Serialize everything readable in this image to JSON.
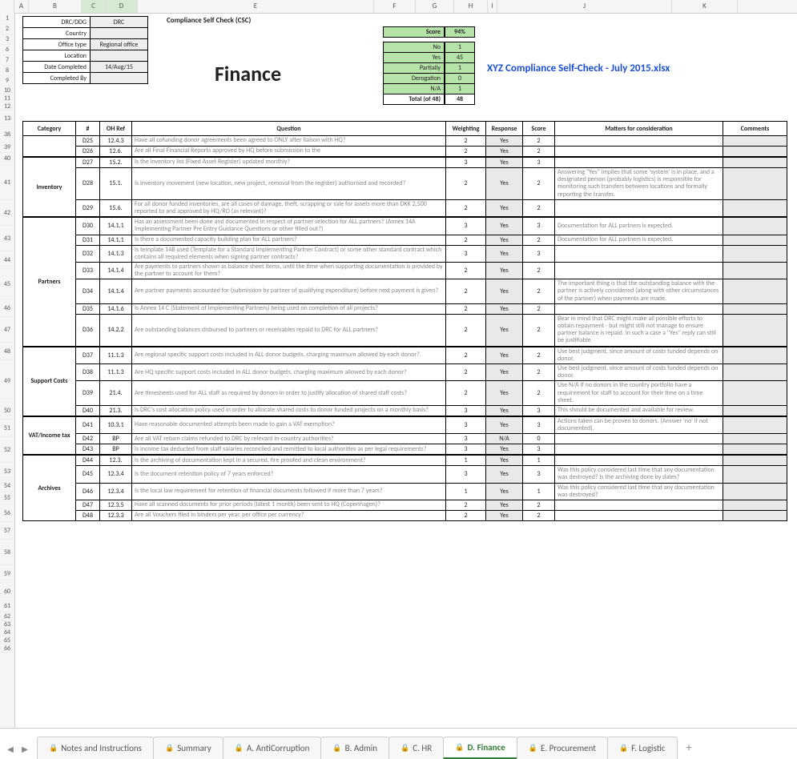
{
  "filename": "XYZ Compliance Self-Check - July 2015.xlsx",
  "header": {
    "title": "Compliance Self Check (CSC)",
    "section": "Finance"
  },
  "info": [
    {
      "label": "DRC/DDG",
      "value": "DRC"
    },
    {
      "label": "Country",
      "value": ""
    },
    {
      "label": "Office type",
      "value": "Regional office"
    },
    {
      "label": "Location",
      "value": ""
    },
    {
      "label": "Date Completed",
      "value": "14/Aug/15"
    },
    {
      "label": "Completed By",
      "value": ""
    }
  ],
  "score": {
    "label": "Score",
    "pct": "94%"
  },
  "summary": [
    {
      "k": "No",
      "v": "1"
    },
    {
      "k": "Yes",
      "v": "45"
    },
    {
      "k": "Partially",
      "v": "1"
    },
    {
      "k": "Derogation",
      "v": "0"
    },
    {
      "k": "N/A",
      "v": "1"
    }
  ],
  "total": {
    "k": "Total (of 48)",
    "v": "48"
  },
  "columns": [
    "A",
    "B",
    "C",
    "D",
    "E",
    "F",
    "G",
    "H",
    "I",
    "J",
    "K"
  ],
  "col_selected": [
    false,
    false,
    true,
    true,
    false,
    false,
    false,
    false,
    false,
    false,
    false
  ],
  "row_numbers": [
    "1",
    "2",
    "3",
    "6",
    "7",
    "8",
    "9",
    "10",
    "11",
    "12",
    "13",
    "38",
    "39",
    "40",
    "41",
    "42",
    "43",
    "44",
    "45",
    "46",
    "47",
    "48",
    "49",
    "50",
    "51",
    "52",
    "53",
    "54",
    "55",
    "56",
    "57",
    "58",
    "59",
    "60",
    "61",
    "62",
    "63",
    "64",
    "65",
    "66"
  ],
  "th": {
    "cat": "Category",
    "num": "#",
    "oh": "OH Ref",
    "q": "Question",
    "w": "Weighting",
    "r": "Response",
    "s": "Score",
    "m": "Matters for consideration",
    "c": "Comments"
  },
  "rows": [
    {
      "cat": "",
      "n": "D25",
      "oh": "12.4.3",
      "q": "Have all cofunding donor agreements been agreed to ONLY after liaison with HQ?",
      "w": "2",
      "r": "Yes",
      "s": "2",
      "m": "",
      "first": true
    },
    {
      "cat": "",
      "n": "D26",
      "oh": "12.6.",
      "q": "Are all Final Financial Reports approved by HQ before submission to the",
      "w": "2",
      "r": "Yes",
      "s": "2",
      "m": ""
    },
    {
      "cat": "",
      "n": "D27",
      "oh": "15.2.",
      "q": "Is the inventory list (Fixed Asset Register) updated monthly?",
      "w": "3",
      "r": "Yes",
      "s": "3",
      "m": "",
      "first": true,
      "thick": true
    },
    {
      "cat": "Inventory",
      "n": "D28",
      "oh": "15.1.",
      "q": "Is inventory movement (new location, new project, removal from the register) authorised and recorded?",
      "w": "2",
      "r": "Yes",
      "s": "2",
      "m": "Answering \"Yes\" implies that some 'system' is in place, and a designated person (probably logistics) is responsible for monitoring such transfers between locations and formally reporting the transfer.",
      "catspan": 3
    },
    {
      "cat": "",
      "n": "D29",
      "oh": "15.6.",
      "q": "For all donor funded inventories, are all cases of damage, theft, scrapping or sale for assets more than DKK 2,500 reported to and approved by HQ/RO (as relevant)?",
      "w": "2",
      "r": "Yes",
      "s": "2",
      "m": ""
    },
    {
      "cat": "",
      "n": "D30",
      "oh": "14.1.1",
      "q": "Has an assessment been done and documented in respect of partner selection for ALL partners?  (Annex 14A Implementing Partner Pre Entry Guidance Questions or other filled out?)",
      "w": "3",
      "r": "Yes",
      "s": "3",
      "m": "Documentation for ALL partners is expected.",
      "first": true,
      "thick": true
    },
    {
      "cat": "",
      "n": "D31",
      "oh": "14.1.1",
      "q": "Is there a documented capacity building plan for ALL partners?",
      "w": "2",
      "r": "Yes",
      "s": "2",
      "m": "Documentation for ALL partners is expected."
    },
    {
      "cat": "",
      "n": "D32",
      "oh": "14.1.3",
      "q": "Is template 14B used (Template for a Standard Implementing Partner Contract) or some other standard contract which contains all required elements when signing partner contracts?",
      "w": "3",
      "r": "Yes",
      "s": "3",
      "m": ""
    },
    {
      "cat": "Partners",
      "n": "D33",
      "oh": "14.1.4",
      "q": "Are payments to partners shown as balance sheet items, until the time when supporting documentation is provided by the partner to account for them?",
      "w": "2",
      "r": "Yes",
      "s": "2",
      "m": "",
      "catspan": 7
    },
    {
      "cat": "",
      "n": "D34",
      "oh": "14.1.4",
      "q": "Are partner payments accounted for (submission by partner of qualifying expenditure) before next payment is given?",
      "w": "2",
      "r": "Yes",
      "s": "2",
      "m": "The important thing is that the outstanding balance with the partner is actively considered (along with other circumstances of the partner) when payments are made."
    },
    {
      "cat": "",
      "n": "D35",
      "oh": "14.1.6",
      "q": "Is Annex 14 C (Statement of Implementing Partners) being used on completion of all projects?",
      "w": "2",
      "r": "Yes",
      "s": "2",
      "m": ""
    },
    {
      "cat": "",
      "n": "D36",
      "oh": "14.2.2",
      "q": "Are outstanding balances disbursed to partners or receivables repaid to DRC for ALL partners?",
      "w": "2",
      "r": "Yes",
      "s": "2",
      "m": "Bear in mind that DRC might make all possible efforts to obtain repayment - but might still not manage to ensure partner balance is repaid.  In such a case a \"Yes\" reply can still be justifiable"
    },
    {
      "cat": "",
      "n": "D37",
      "oh": "11.1.3",
      "q": "Are regional specific support costs included in ALL donor budgets, charging maximum allowed by each donor?",
      "w": "2",
      "r": "Yes",
      "s": "2",
      "m": "Use best judgment, since amount of costs funded depends on donor.",
      "first": true,
      "thick": true
    },
    {
      "cat": "Support Costs",
      "n": "D38",
      "oh": "11.1.3",
      "q": "Are HQ specific support costs included in ALL donor budgets, charging maximum allowed by each donor?",
      "w": "2",
      "r": "Yes",
      "s": "2",
      "m": "Use best judgment, since amount of costs funded depends on donor.",
      "catspan": 4
    },
    {
      "cat": "",
      "n": "D39",
      "oh": "21.4.",
      "q": "Are timesheets used for ALL staff as required by donors in order to justify allocation of shared staff costs?",
      "w": "2",
      "r": "Yes",
      "s": "2",
      "m": "Use N/A if no donors in the country portfolio have a requirement for  staff to account for their time on a time sheet."
    },
    {
      "cat": "",
      "n": "D40",
      "oh": "21.3.",
      "q": "Is DRC's cost allocation policy used in order to allocate shared costs to donor funded projects on a monthly basis?",
      "w": "3",
      "r": "Yes",
      "s": "3",
      "m": "This should be documented and available for review."
    },
    {
      "cat": "",
      "n": "D41",
      "oh": "10.3.1",
      "q": "Have reasonable documented attempts been made to gain a VAT exemption?",
      "w": "3",
      "r": "Yes",
      "s": "3",
      "m": "Actions taken can be proven to donors.  (Answer 'no' if not documented).",
      "first": true,
      "thick": true
    },
    {
      "cat": "VAT/Income tax",
      "n": "D42",
      "oh": "BP",
      "q": "Are all VAT return claims refunded to DRC by relevant in-country authorities?",
      "w": "3",
      "r": "N/A",
      "s": "0",
      "m": "",
      "catspan": 3
    },
    {
      "cat": "",
      "n": "D43",
      "oh": "BP",
      "q": "Is income tax deducted from staff salaries reconciled  and remitted to local authorities as per legal requirements?",
      "w": "3",
      "r": "Yes",
      "s": "3",
      "m": ""
    },
    {
      "cat": "",
      "n": "D44",
      "oh": "12.3.",
      "q": "Is the archiving of documentation kept in a secured, fire proofed and clean environment?",
      "w": "1",
      "r": "Yes",
      "s": "1",
      "m": "",
      "first": true,
      "thick": true
    },
    {
      "cat": "Archives",
      "n": "D45",
      "oh": "12.3.4",
      "q": "Is the document retention policy of 7 years enforced?",
      "w": "3",
      "r": "Yes",
      "s": "3",
      "m": "Was this policy considered last time that any documentation was destroyed? Is the archiving done by dates?",
      "catspan": 5
    },
    {
      "cat": "",
      "n": "D46",
      "oh": "12.3.4",
      "q": "Is the  local law requirement for retention of  financial documents followed if more than 7 years?",
      "w": "1",
      "r": "Yes",
      "s": "1",
      "m": "Was this policy considered last time that any documentation was destroyed?"
    },
    {
      "cat": "",
      "n": "D47",
      "oh": "12.3.5",
      "q": "Have all scanned documents for prior periods (latest 1 month) been sent to HQ (Copenhagen)?",
      "w": "2",
      "r": "Yes",
      "s": "2",
      "m": ""
    },
    {
      "cat": "",
      "n": "D48",
      "oh": "12.3.3",
      "q": "Are all Vouchers  filed in binders per year, per office per currency?",
      "w": "2",
      "r": "Yes",
      "s": "2",
      "m": ""
    }
  ],
  "tabs": [
    {
      "label": "Notes and Instructions",
      "active": false
    },
    {
      "label": "Summary",
      "active": false
    },
    {
      "label": "A. AntiCorruption",
      "active": false
    },
    {
      "label": "B. Admin",
      "active": false
    },
    {
      "label": "C. HR",
      "active": false
    },
    {
      "label": "D. Finance",
      "active": true
    },
    {
      "label": "E. Procurement",
      "active": false
    },
    {
      "label": "F. Logistic",
      "active": false
    }
  ]
}
